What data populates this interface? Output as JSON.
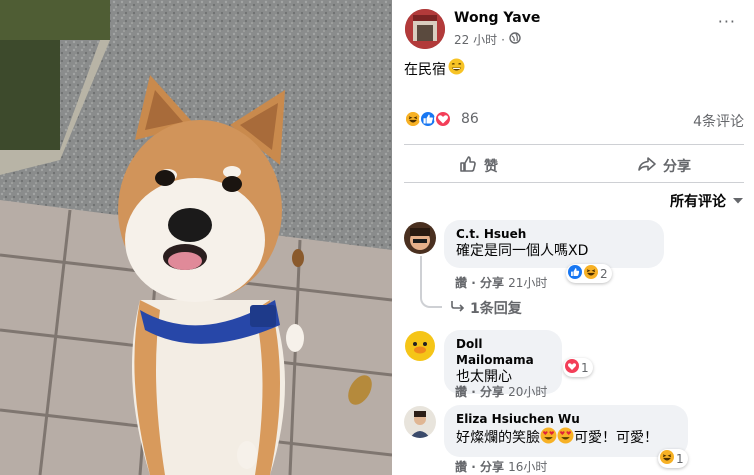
{
  "post": {
    "author": "Wong Yave",
    "timestamp": "22 小时",
    "separator": "·",
    "caption": "在民宿",
    "reaction_count": "86",
    "comment_count": "4条评论",
    "like_label": "赞",
    "share_label": "分享",
    "sort_label": "所有评论",
    "more_label": "···"
  },
  "comments": [
    {
      "name": "C.t. Hsueh",
      "text": "確定是同一個人嗎XD",
      "like": "讚",
      "dot": "·",
      "share": "分享",
      "time": "21小时",
      "reaction_count": "2",
      "replies_label": "1条回复"
    },
    {
      "name": "Doll Mailomama",
      "text": "也太開心",
      "like": "讚",
      "dot": "·",
      "share": "分享",
      "time": "20小时",
      "reaction_count": "1"
    },
    {
      "name": "Eliza Hsiuchen Wu",
      "text_before": "好燦爛的笑臉",
      "text_after": "可愛！可愛！",
      "like": "讚",
      "dot": "·",
      "share": "分享",
      "time": "16小时",
      "reaction_count": "1"
    }
  ],
  "colors": {
    "like_blue": "#1877f2",
    "love_red": "#f33e58",
    "haha_yellow": "#f7b125",
    "secondary_text": "#65676b",
    "bubble_bg": "#f0f2f5"
  },
  "icons": [
    "globe-icon",
    "grin-emoji",
    "haha-reaction",
    "like-reaction",
    "love-reaction",
    "thumbs-up-icon",
    "share-arrow-icon",
    "chevron-down-icon",
    "heart-eyes-emoji",
    "reply-arrow-icon"
  ]
}
